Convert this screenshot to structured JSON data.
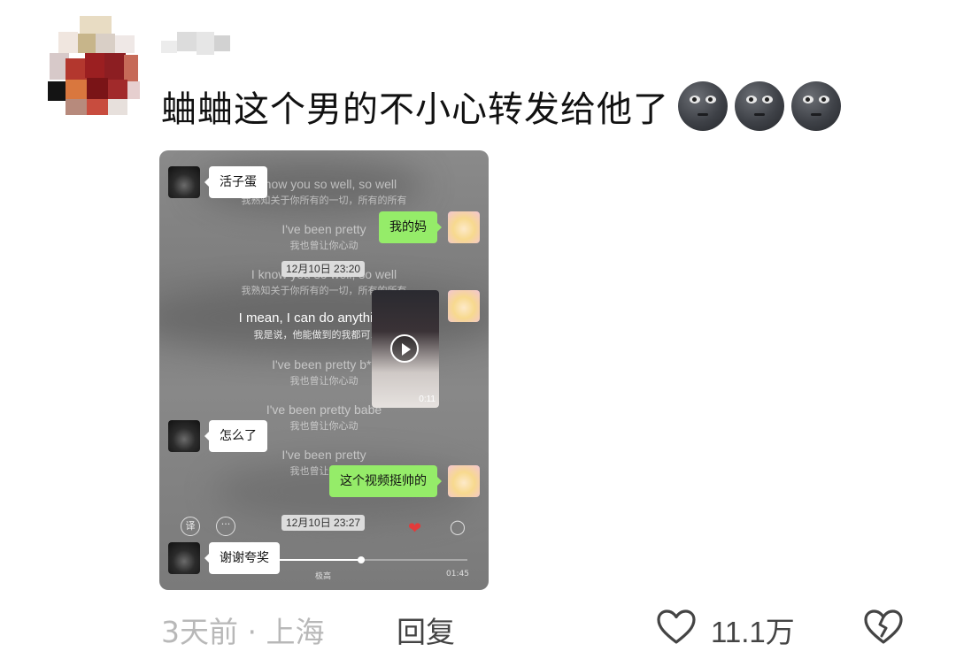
{
  "comment": {
    "text": "蛐蛐这个男的不小心转发给他了",
    "emoji": [
      "new-moon-face-emoji",
      "new-moon-face-emoji",
      "new-moon-face-emoji"
    ]
  },
  "screenshot": {
    "lyrics": [
      {
        "en": "I know you so well, so well",
        "zh": "我熟知关于你所有的一切，所有的所有"
      },
      {
        "en": "I've been pretty",
        "zh": "我也曾让你心动"
      },
      {
        "en": "I know you so well, so well",
        "zh": "我熟知关于你所有的一切，所有的所有"
      },
      {
        "en": "I mean, I can do anything t",
        "zh": "我是说，他能做到的我都可以"
      },
      {
        "en": "I've been pretty b**",
        "zh": "我也曾让你心动"
      },
      {
        "en": "I've been pretty babe",
        "zh": "我也曾让你心动"
      },
      {
        "en": "I've been pretty",
        "zh": "我也曾让你心动"
      }
    ],
    "messages": {
      "m1": "活子蛋",
      "m2": "我的妈",
      "m3": "怎么了",
      "m4": "这个视频挺帅的",
      "m5": "谢谢夸奖"
    },
    "timestamps": {
      "t1": "12月10日 23:20",
      "t2": "12月10日 23:27"
    },
    "video_duration": "0:11",
    "player": {
      "translate_label": "译",
      "more_label": "···",
      "quality_label": "极高",
      "elapsed": "",
      "total": "01:45",
      "progress": 0.45
    }
  },
  "footer": {
    "meta": "3天前 · 上海",
    "reply_label": "回复",
    "like_count": "11.1万"
  }
}
